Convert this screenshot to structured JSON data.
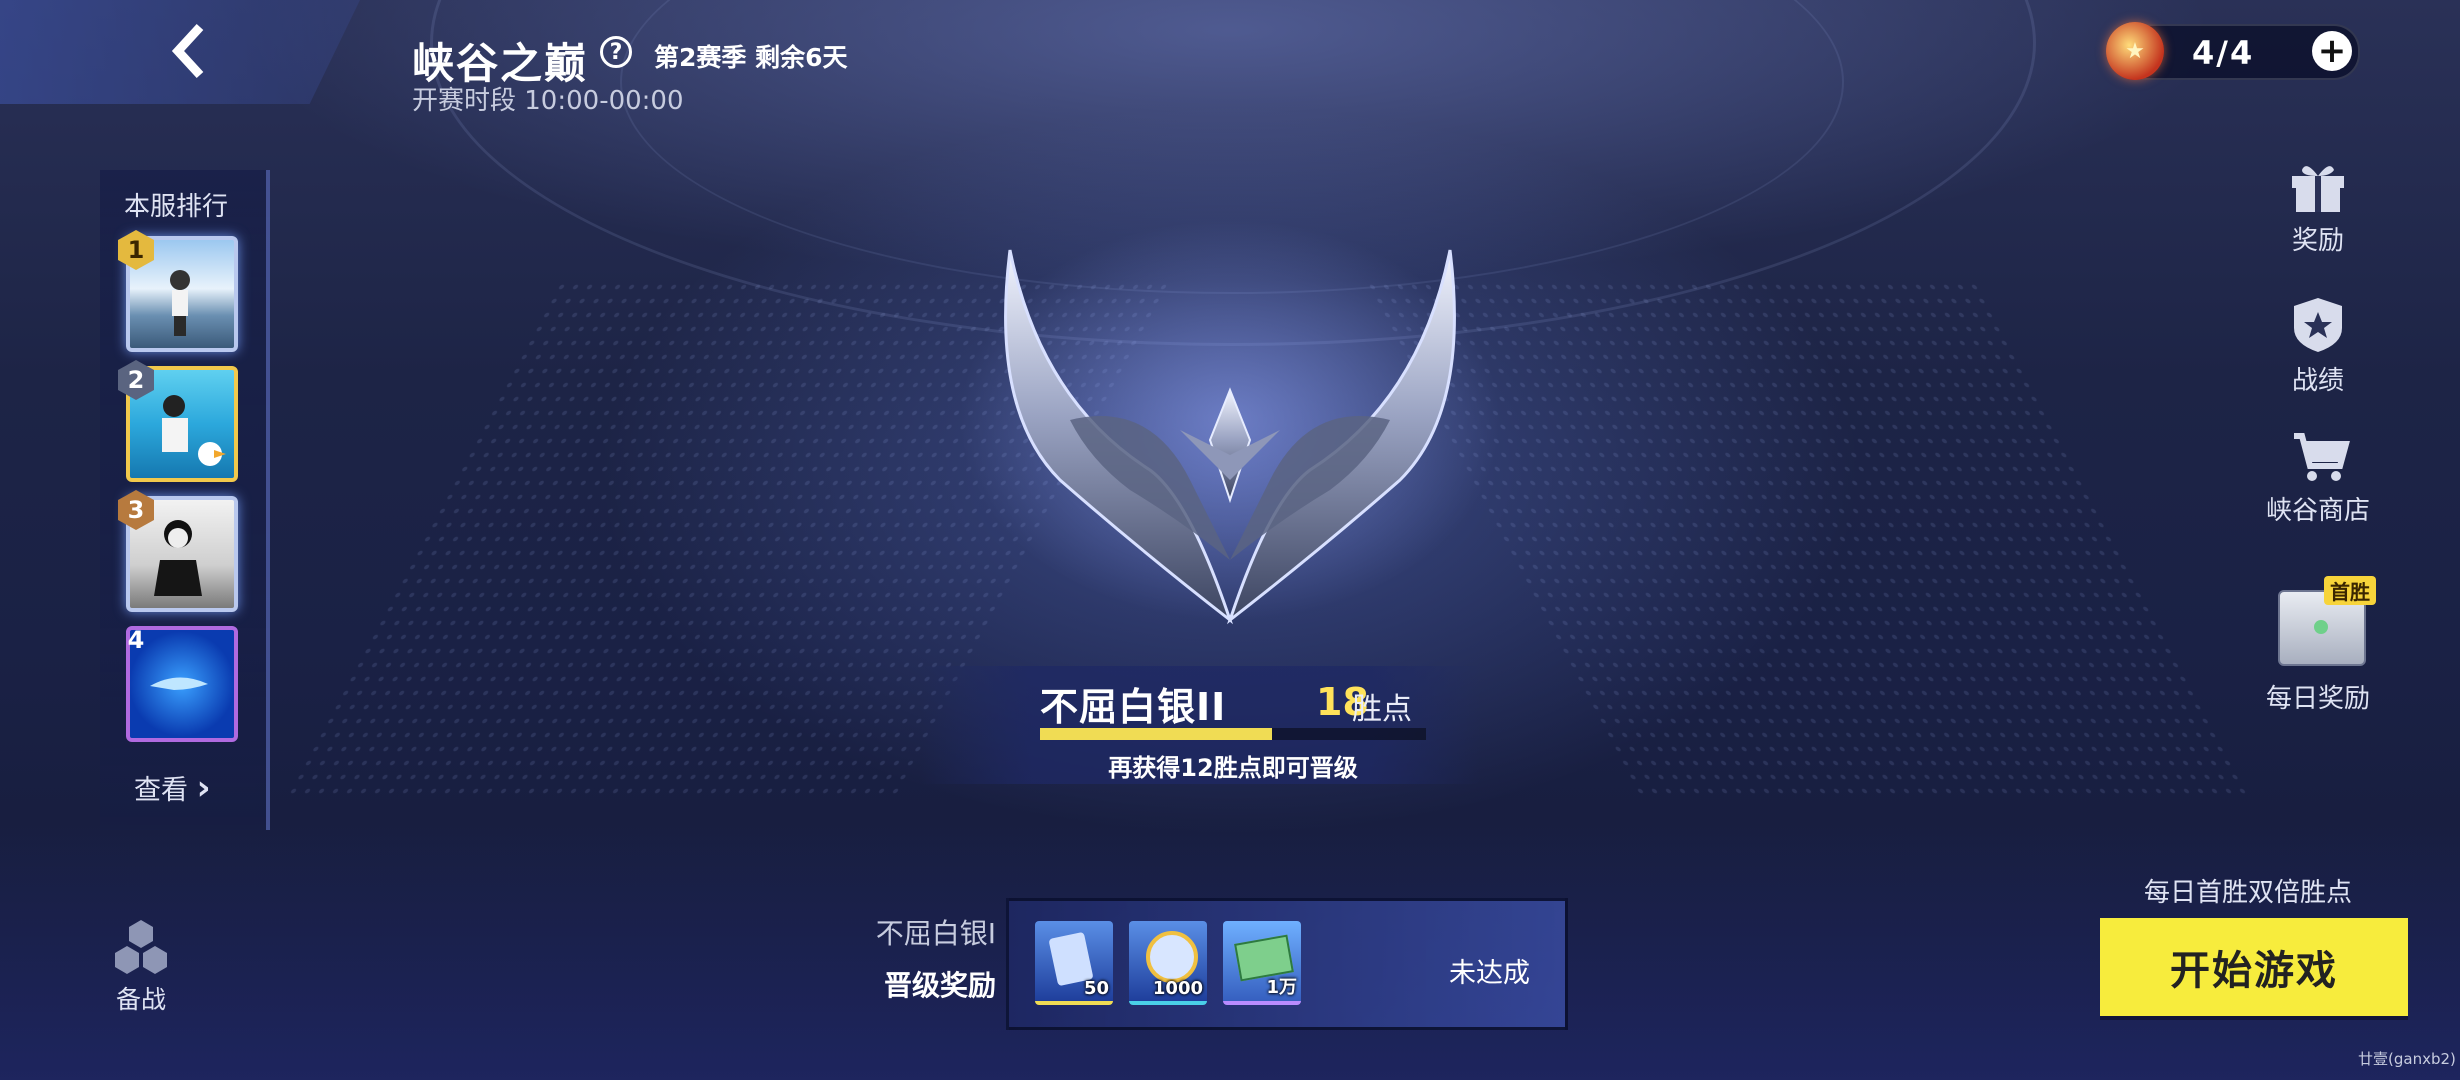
{
  "header": {
    "title": "峡谷之巅",
    "help_symbol": "?",
    "season_info": "第2赛季 剩余6天",
    "match_period": "开赛时段 10:00-00:00"
  },
  "ticket": {
    "count": "4/4",
    "plus_symbol": "+"
  },
  "ranking": {
    "title": "本服排行",
    "items": [
      {
        "rank": "1"
      },
      {
        "rank": "2"
      },
      {
        "rank": "3"
      },
      {
        "rank": "4"
      }
    ],
    "view_label": "查看",
    "view_arrow": "›"
  },
  "prep": {
    "label": "备战"
  },
  "side_menu": {
    "rewards": "奖励",
    "record": "战绩",
    "shop": "峡谷商店",
    "daily_badge": "首胜",
    "daily_reward": "每日奖励"
  },
  "rank_status": {
    "tier": "不屈白银II",
    "points": "18",
    "points_unit": "胜点",
    "progress_fraction": 0.6,
    "promotion_hint": "再获得12胜点即可晋级"
  },
  "promotion": {
    "next_tier": "不屈白银I",
    "label": "晋级奖励",
    "items": [
      {
        "qty": "50",
        "icon": "card-icon"
      },
      {
        "qty": "1000",
        "icon": "medal-icon"
      },
      {
        "qty": "1万",
        "icon": "cash-icon"
      }
    ],
    "status": "未达成"
  },
  "start": {
    "double_points": "每日首胜双倍胜点",
    "button": "开始游戏"
  },
  "watermark": "廿壹(ganxb2)",
  "colors": {
    "accent_yellow": "#f7ec3d",
    "points_yellow": "#ffe25a",
    "background": "#1d2446"
  }
}
